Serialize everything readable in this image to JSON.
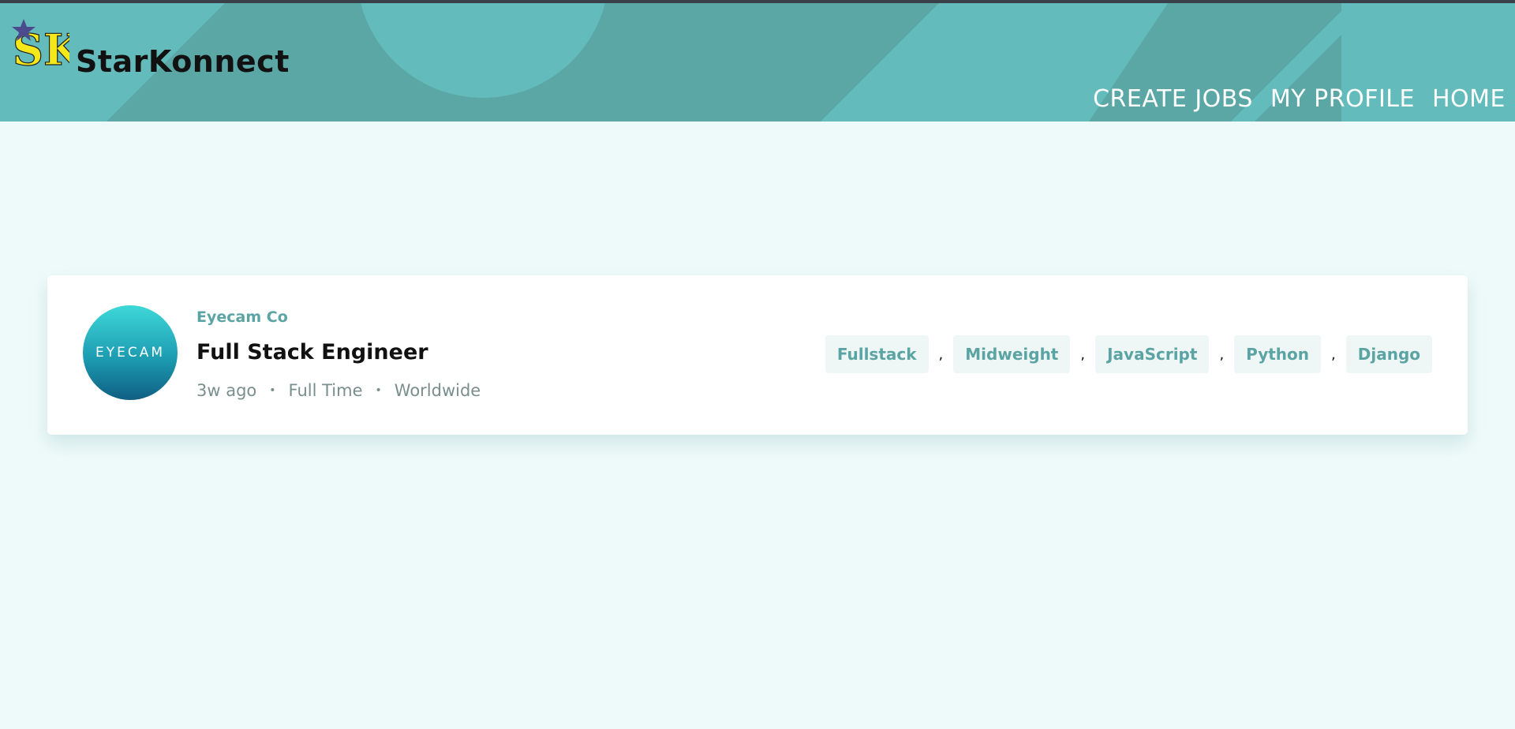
{
  "app": {
    "brand": "StarKonnect",
    "logo_letters": "SK",
    "logo_icon": "star-icon"
  },
  "nav": {
    "create_jobs": "CREATE JOBS",
    "my_profile": "MY PROFILE",
    "home": "HOME"
  },
  "job": {
    "company_logo_text": "EYECAM",
    "company": "Eyecam Co",
    "title": "Full Stack Engineer",
    "posted": "3w ago",
    "contract": "Full Time",
    "location": "Worldwide",
    "meta_separator": "•",
    "tag_separator": ",",
    "tags": [
      "Fullstack",
      "Midweight",
      "JavaScript",
      "Python",
      "Django"
    ]
  },
  "colors": {
    "header": "#63bbbb",
    "accent": "#5ba4a4",
    "background": "#eefaf9",
    "logo_yellow": "#f5e81a",
    "star": "#4b4a8c"
  }
}
